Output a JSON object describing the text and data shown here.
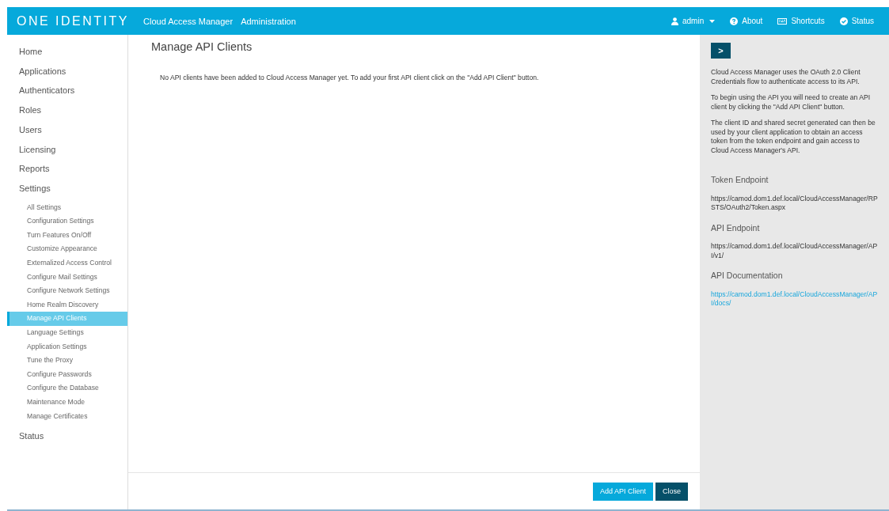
{
  "header": {
    "logo": "ONE IDENTITY",
    "product": "Cloud Access Manager",
    "section": "Administration",
    "actions": [
      {
        "kind": "user",
        "label": "admin"
      },
      {
        "kind": "help",
        "label": "About"
      },
      {
        "kind": "keyboard",
        "label": "Shortcuts"
      },
      {
        "kind": "check",
        "label": "Status"
      }
    ]
  },
  "sidebar": {
    "items": [
      {
        "label": "Home",
        "selected": false
      },
      {
        "label": "Applications",
        "selected": false
      },
      {
        "label": "Authenticators",
        "selected": false
      },
      {
        "label": "Roles",
        "selected": false
      },
      {
        "label": "Users",
        "selected": false
      },
      {
        "label": "Licensing",
        "selected": false
      },
      {
        "label": "Reports",
        "selected": false
      },
      {
        "label": "Settings",
        "selected": false,
        "children": [
          {
            "label": "All Settings",
            "selected": false
          },
          {
            "label": "Configuration Settings",
            "selected": false
          },
          {
            "label": "Turn Features On/Off",
            "selected": false
          },
          {
            "label": "Customize Appearance",
            "selected": false
          },
          {
            "label": "Externalized Access Control",
            "selected": false
          },
          {
            "label": "Configure Mail Settings",
            "selected": false
          },
          {
            "label": "Configure Network Settings",
            "selected": false
          },
          {
            "label": "Home Realm Discovery",
            "selected": false
          },
          {
            "label": "Manage API Clients",
            "selected": true
          },
          {
            "label": "Language Settings",
            "selected": false
          },
          {
            "label": "Application Settings",
            "selected": false
          },
          {
            "label": "Tune the Proxy",
            "selected": false
          },
          {
            "label": "Configure Passwords",
            "selected": false
          },
          {
            "label": "Configure the Database",
            "selected": false
          },
          {
            "label": "Maintenance Mode",
            "selected": false
          },
          {
            "label": "Manage Certificates",
            "selected": false
          }
        ]
      },
      {
        "label": "Status",
        "selected": false
      }
    ]
  },
  "main": {
    "title": "Manage API Clients",
    "message": "No API clients have been added to Cloud Access Manager yet. To add your first API client click on the \"Add API Client\" button.",
    "buttons": [
      {
        "kind": "primary",
        "label": "Add API Client"
      },
      {
        "kind": "secondary",
        "label": "Close"
      }
    ]
  },
  "help_panel": {
    "toggle": ">",
    "paragraphs": [
      "Cloud Access Manager uses the OAuth 2.0 Client Credentials flow to authenticate access to its API.",
      "To begin using the API you will need to create an API client by clicking the \"Add API Client\" button.",
      "The client ID and shared secret generated can then be used by your client application to obtain an access token from the token endpoint and gain access to Cloud Access Manager's API."
    ],
    "sections": [
      {
        "heading": "Token Endpoint",
        "kind": "text",
        "value": "https://camod.dom1.def.local/CloudAccessManager/RPSTS/OAuth2/Token.aspx"
      },
      {
        "heading": "API Endpoint",
        "kind": "text",
        "value": "https://camod.dom1.def.local/CloudAccessManager/API/v1/"
      },
      {
        "heading": "API Documentation",
        "kind": "link",
        "value": "https://camod.dom1.def.local/CloudAccessManager/API/docs/"
      }
    ]
  }
}
